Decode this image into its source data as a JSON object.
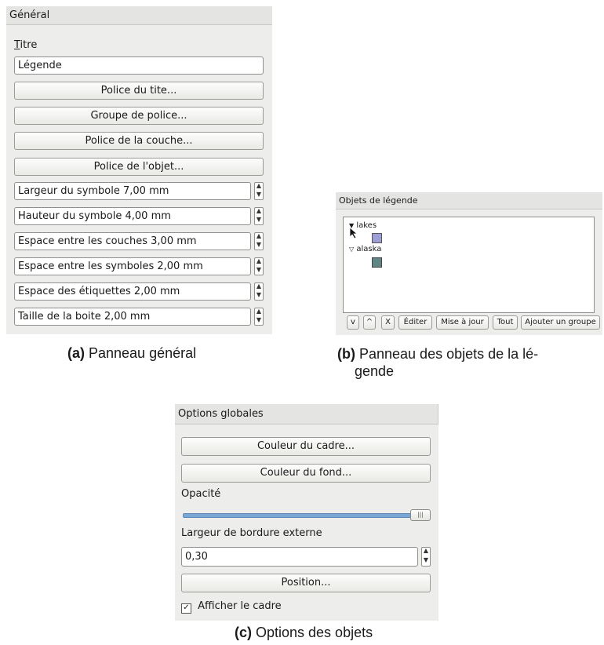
{
  "panel_a": {
    "header": "Général",
    "title_label_first": "T",
    "title_label_rest": "itre",
    "title_value": "Légende",
    "buttons": [
      "Police du tite...",
      "Groupe de police...",
      "Police de la couche...",
      "Police de l'objet..."
    ],
    "spinboxes": [
      "Largeur du symbole 7,00 mm",
      "Hauteur du symbole 4,00 mm",
      "Espace entre les couches 3,00 mm",
      "Espace entre les symboles 2,00 mm",
      "Espace des étiquettes 2,00 mm",
      "Taille de la boite 2,00 mm"
    ],
    "caption_tag": "(a)",
    "caption_text": " Panneau général"
  },
  "panel_b": {
    "header": "Objets de légende",
    "items": [
      {
        "label": "lakes",
        "color": "#9e9ed6"
      },
      {
        "label": "alaska",
        "color": "#5f8585"
      }
    ],
    "buttons": [
      "v",
      "^",
      "X",
      "Éditer",
      "Mise à jour",
      "Tout",
      "Ajouter un groupe"
    ],
    "caption_tag": "(b)",
    "caption_line1": " Panneau des objets de la lé-",
    "caption_line2": "gende"
  },
  "panel_c": {
    "header": "Options globales",
    "frame_color_button": "Couleur du cadre...",
    "bg_color_button": "Couleur du fond...",
    "opacity_label": "Opacité",
    "opacity_value": 1.0,
    "border_width_label": "Largeur de bordure externe",
    "border_width_value": "0,30",
    "position_button": "Position...",
    "show_frame_label": "Afficher le cadre",
    "show_frame_checked": true,
    "caption_tag": "(c)",
    "caption_text": " Options des objets"
  },
  "colors": {
    "slider_fill": "#7aa6d6",
    "panel_bg": "#ededeb"
  }
}
